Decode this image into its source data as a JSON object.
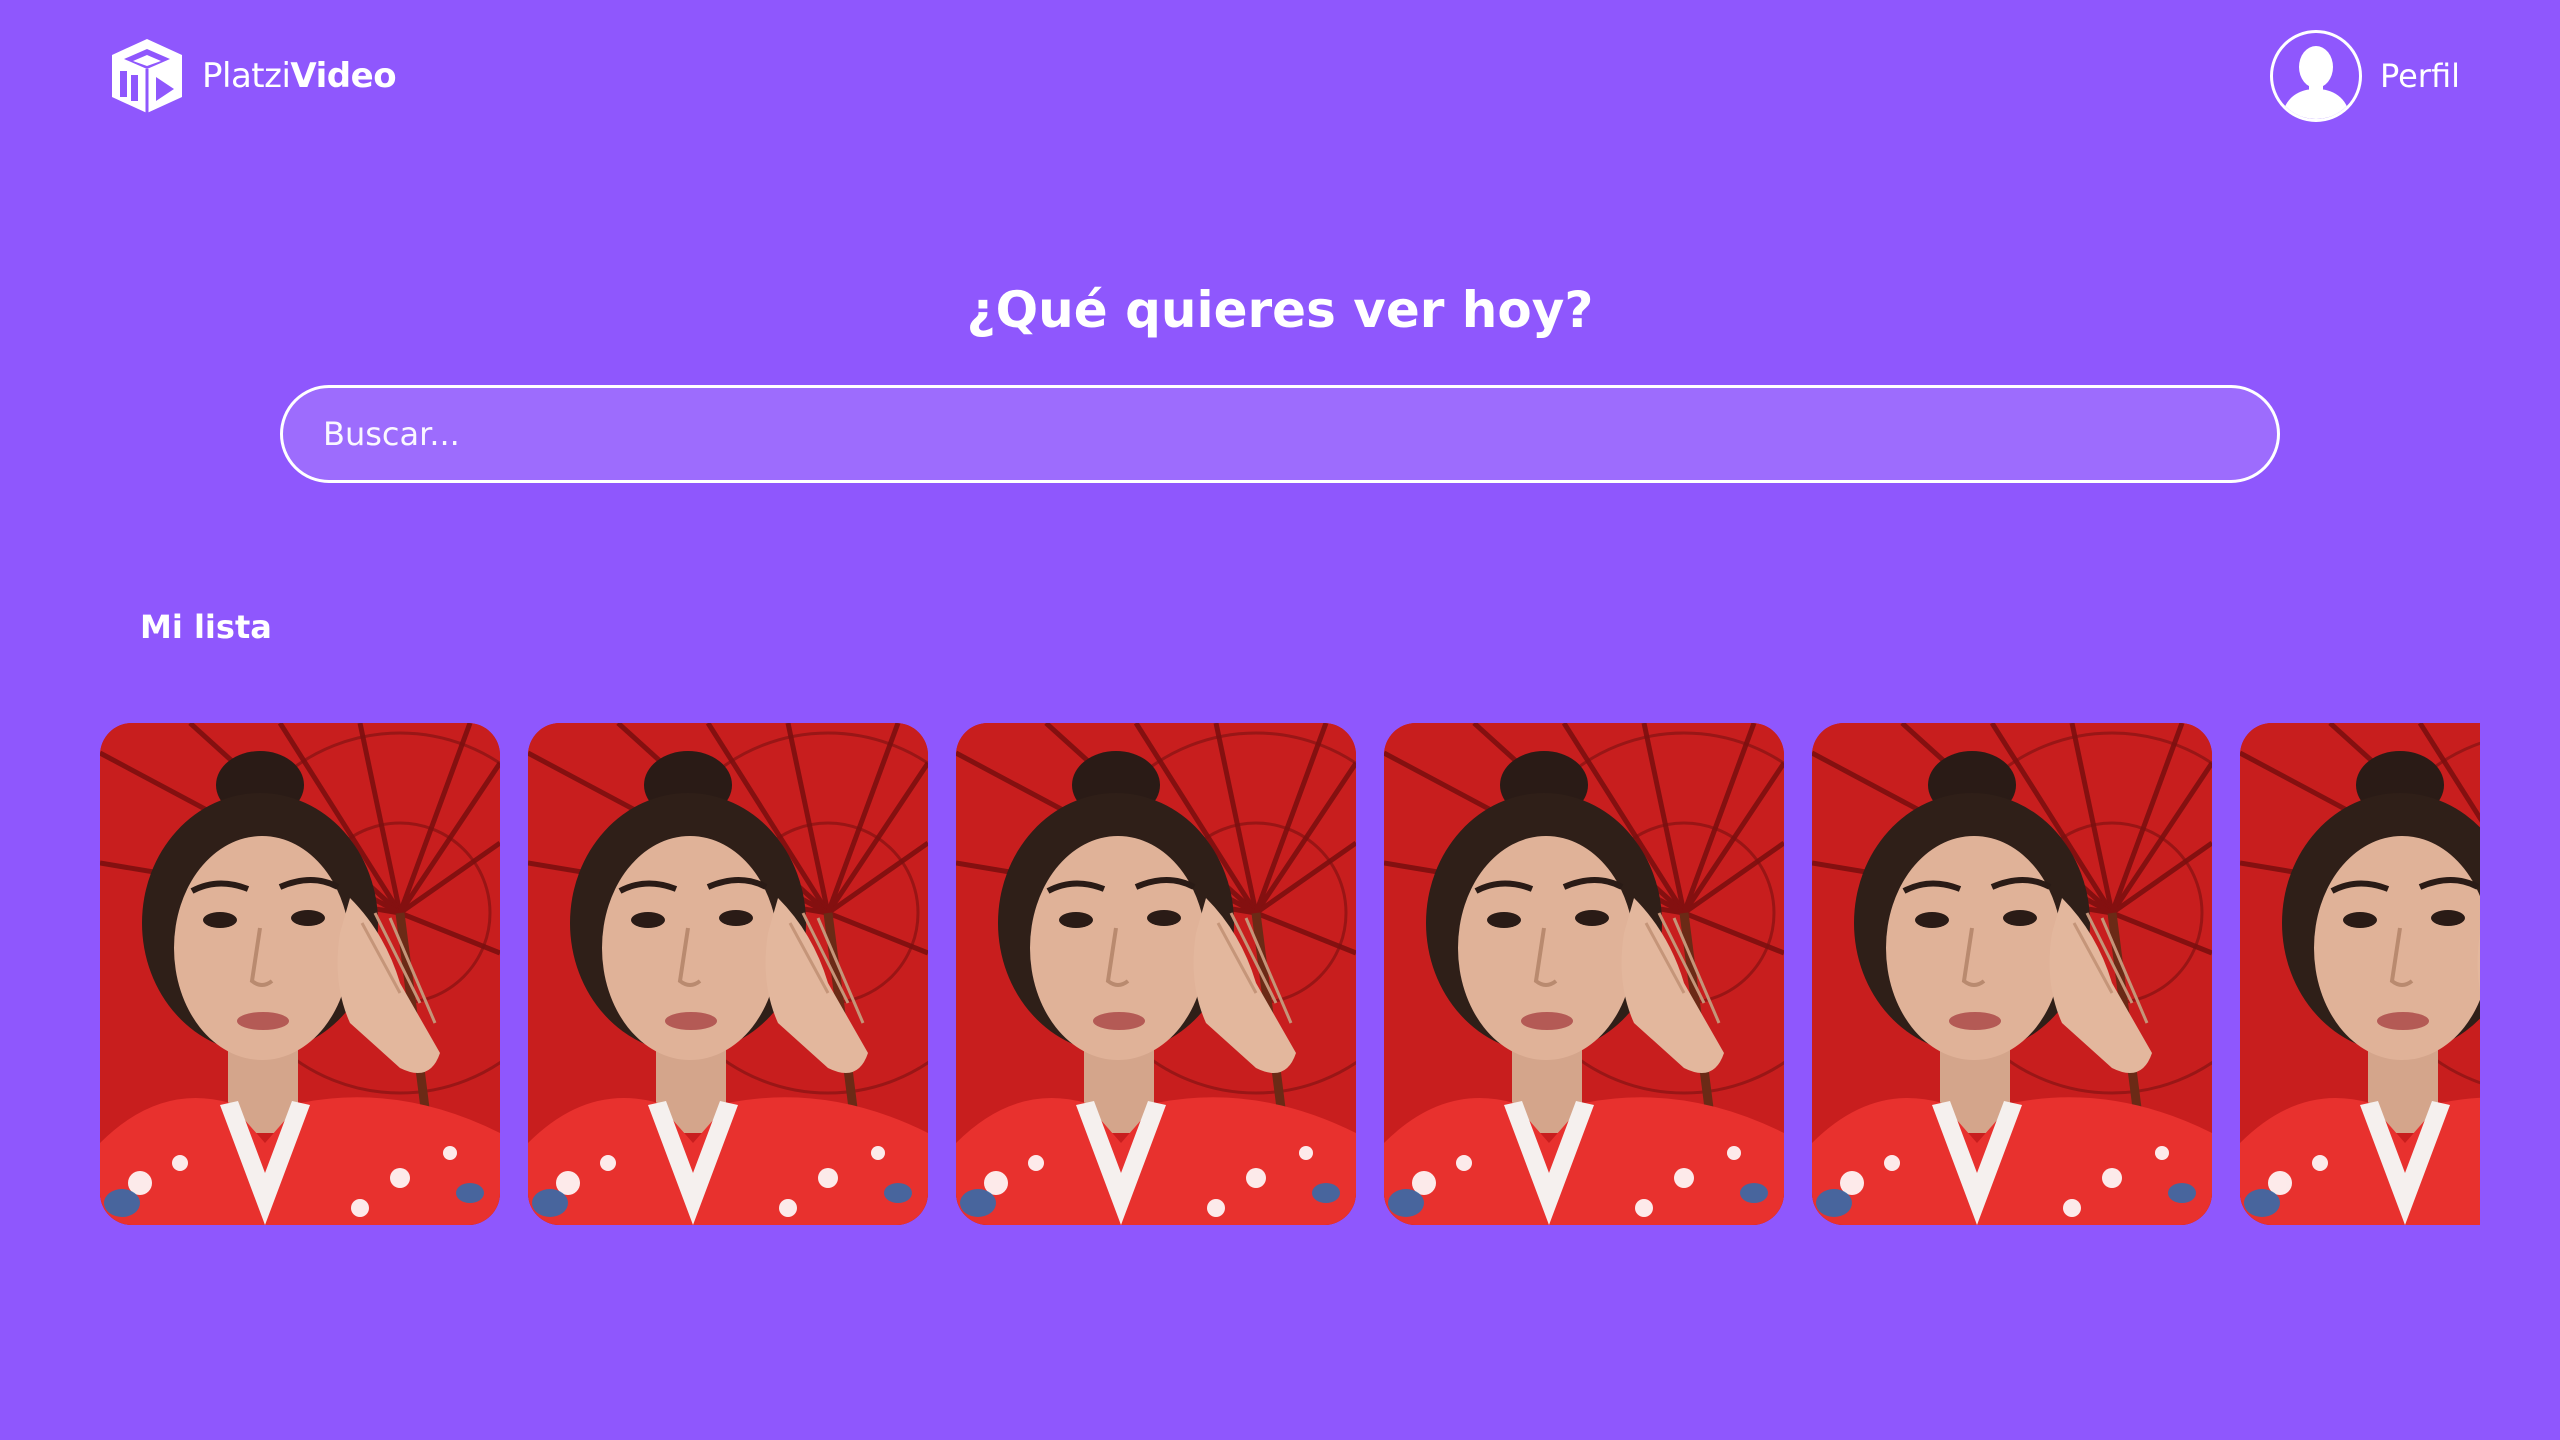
{
  "header": {
    "logo": {
      "text_light": "Platzi",
      "text_bold": "Video",
      "icon": "cube-play-icon"
    },
    "profile": {
      "label": "Perfil",
      "icon": "user-avatar-icon"
    }
  },
  "main": {
    "title": "¿Qué quieres ver hoy?",
    "search": {
      "placeholder": "Buscar...",
      "value": ""
    },
    "sections": [
      {
        "title": "Mi lista",
        "items": [
          {
            "image": "portrait-woman-red-umbrella"
          },
          {
            "image": "portrait-woman-red-umbrella"
          },
          {
            "image": "portrait-woman-red-umbrella"
          },
          {
            "image": "portrait-woman-red-umbrella"
          },
          {
            "image": "portrait-woman-red-umbrella"
          },
          {
            "image": "portrait-woman-red-umbrella"
          }
        ]
      }
    ]
  },
  "colors": {
    "background": "#8f57fd",
    "text": "#ffffff",
    "umbrella_red": "#c81e1e",
    "kimono_red": "#e8312e"
  }
}
